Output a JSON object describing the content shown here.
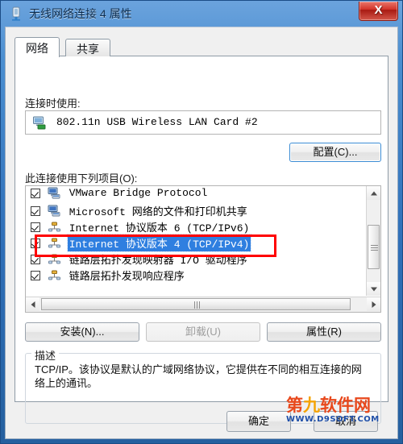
{
  "window": {
    "title": "无线网络连接 4 属性",
    "icon": "network-adapter-icon",
    "close_label": "X"
  },
  "tabs": [
    {
      "label": "网络",
      "active": true
    },
    {
      "label": "共享",
      "active": false
    }
  ],
  "connect_using": {
    "label": "连接时使用:",
    "adapter_name": "802.11n USB Wireless LAN Card #2",
    "configure_button": "配置(C)..."
  },
  "items_section": {
    "label": "此连接使用下列项目(O):",
    "items": [
      {
        "label": "VMware Bridge Protocol",
        "checked": true,
        "icon": "network-client-icon",
        "selected": false
      },
      {
        "label": "Microsoft 网络的文件和打印机共享",
        "checked": true,
        "icon": "network-client-icon",
        "selected": false
      },
      {
        "label": "Internet 协议版本 6 (TCP/IPv6)",
        "checked": true,
        "icon": "protocol-icon",
        "selected": false
      },
      {
        "label": "Internet 协议版本 4 (TCP/IPv4)",
        "checked": true,
        "icon": "protocol-icon",
        "selected": true
      },
      {
        "label": "链路层拓扑发现映射器 I/O 驱动程序",
        "checked": true,
        "icon": "protocol-icon",
        "selected": false
      },
      {
        "label": "链路层拓扑发现响应程序",
        "checked": true,
        "icon": "protocol-icon",
        "selected": false
      }
    ]
  },
  "action_buttons": {
    "install": "安装(N)...",
    "uninstall": "卸载(U)",
    "uninstall_disabled": true,
    "properties": "属性(R)"
  },
  "description": {
    "title": "描述",
    "text": "TCP/IP。该协议是默认的广域网络协议，它提供在不同的相互连接的网络上的通讯。"
  },
  "dialog_buttons": {
    "ok": "确定",
    "cancel": "取消"
  },
  "watermark": {
    "line1_part1": "第",
    "line1_part2": "九",
    "line1_part3": "软件网",
    "line2": "WWW.D9SOFT.COM"
  },
  "annotation": {
    "color": "#ff0000",
    "target": "Internet 协议版本 4 (TCP/IPv4)"
  }
}
